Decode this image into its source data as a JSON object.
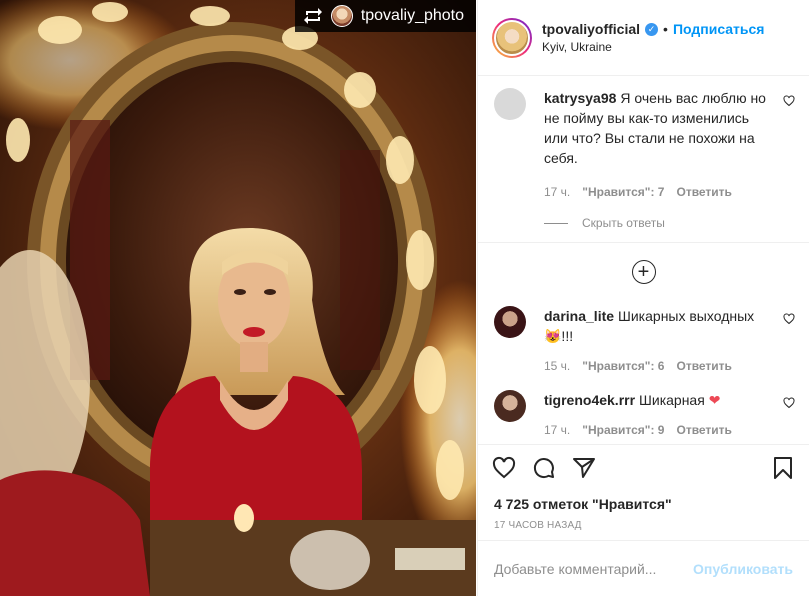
{
  "repost": {
    "handle": "tpovaliy_photo"
  },
  "header": {
    "username": "tpovaliyofficial",
    "dot": "•",
    "follow_label": "Подписаться",
    "location": "Kyiv, Ukraine"
  },
  "comments": [
    {
      "user": "katrysya98",
      "text": "Я очень вас люблю но не пойму вы как-то изменились или что? Вы стали не похожи на себя.",
      "time": "17 ч.",
      "likes": "\"Нравится\": 7",
      "reply": "Ответить"
    },
    {
      "user": "darina_lite",
      "text": "Шикарных выходных 😻!!!",
      "time": "15 ч.",
      "likes": "\"Нравится\": 6",
      "reply": "Ответить"
    },
    {
      "user": "tigreno4ek.rrr",
      "text": "Шикарная",
      "emoji": "❤",
      "time": "17 ч.",
      "likes": "\"Нравится\": 9",
      "reply": "Ответить"
    }
  ],
  "hide_replies": "Скрыть ответы",
  "more_symbol": "+",
  "likes_count": "4 725 отметок \"Нравится\"",
  "time_ago": "17 ЧАСОВ НАЗАД",
  "add_comment": {
    "placeholder": "Добавьте комментарий...",
    "publish": "Опубликовать"
  },
  "colors": {
    "accent": "#0095f6",
    "publish_disabled": "#b2dffc",
    "heart": "#ed4956"
  }
}
